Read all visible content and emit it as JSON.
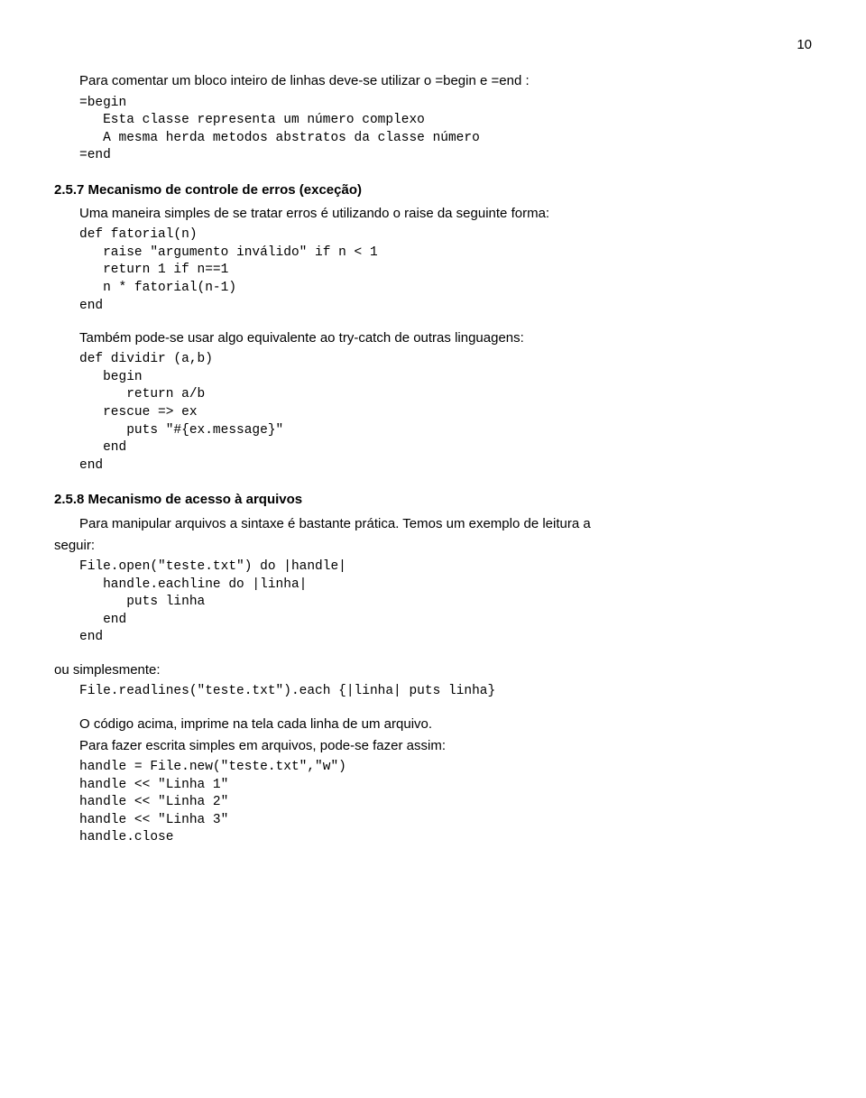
{
  "page_number": "10",
  "p1": "Para comentar um bloco inteiro de linhas deve-se utilizar o =begin e =end :",
  "code1": "=begin\n   Esta classe representa um número complexo\n   A mesma herda metodos abstratos da classe número\n=end",
  "h_257": "2.5.7 Mecanismo de controle de erros (exceção)",
  "p2": "Uma maneira simples de se tratar erros é utilizando o raise da seguinte forma:",
  "code2": "def fatorial(n)\n   raise \"argumento inválido\" if n < 1\n   return 1 if n==1\n   n * fatorial(n-1)\nend",
  "p3": "Também pode-se usar algo equivalente ao try-catch de outras linguagens:",
  "code3": "def dividir (a,b)\n   begin\n      return a/b\n   rescue => ex\n      puts \"#{ex.message}\"\n   end\nend",
  "h_258": "2.5.8 Mecanismo de acesso à arquivos",
  "p4a": "Para manipular arquivos a sintaxe é bastante prática. Temos um exemplo de leitura a",
  "p4b": "seguir:",
  "code4": "File.open(\"teste.txt\") do |handle|\n   handle.eachline do |linha|\n      puts linha\n   end\nend",
  "p5": "ou simplesmente:",
  "code5": "File.readlines(\"teste.txt\").each {|linha| puts linha}",
  "p6": "O código acima, imprime na tela cada linha de um arquivo.",
  "p7": "Para fazer escrita simples em arquivos, pode-se fazer assim:",
  "code6": "handle = File.new(\"teste.txt\",\"w\")\nhandle << \"Linha 1\"\nhandle << \"Linha 2\"\nhandle << \"Linha 3\"\nhandle.close"
}
